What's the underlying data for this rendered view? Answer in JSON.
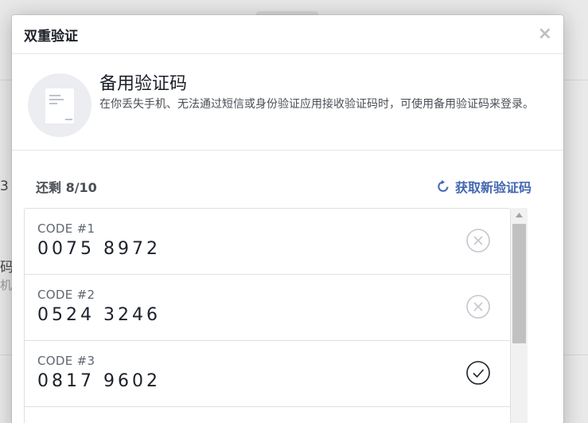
{
  "background": {
    "fragment_1": "3",
    "fragment_2": "码",
    "fragment_3": "机"
  },
  "modal": {
    "title": "双重验证",
    "close_glyph": "×",
    "intro": {
      "heading": "备用验证码",
      "description": "在你丢失手机、无法通过短信或身份验证应用接收验证码时，可使用备用验证码来登录。",
      "icon": "document-icon"
    },
    "toolbar": {
      "remaining": "还剩 8/10",
      "get_new_label": "获取新验证码",
      "get_new_icon": "refresh-icon"
    },
    "codes": [
      {
        "label": "CODE #1",
        "value": "0075 8972",
        "status": "unused",
        "status_icon": "x-circle-icon"
      },
      {
        "label": "CODE #2",
        "value": "0524 3246",
        "status": "unused",
        "status_icon": "x-circle-icon"
      },
      {
        "label": "CODE #3",
        "value": "0817 9602",
        "status": "used",
        "status_icon": "check-circle-icon"
      }
    ]
  },
  "colors": {
    "accent": "#4267b2",
    "text_primary": "#1d2129",
    "border": "#dddfe2"
  }
}
